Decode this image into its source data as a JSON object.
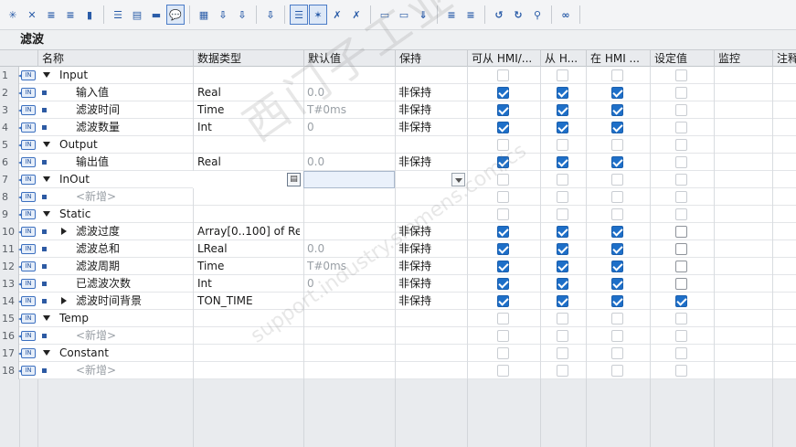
{
  "block_title": "滤波",
  "toolbar": {
    "icons": [
      "insert-row-icon",
      "add-row-icon",
      "move-up-icon",
      "move-down-icon",
      "reset-icon",
      "expand-icon",
      "collapse-icon",
      "block-icon",
      "comment-icon",
      "monitor-list-icon",
      "snapshot-icon",
      "load-start-icon",
      "view-icon",
      "highlight-icon",
      "break-icon",
      "delete-snapshot-icon",
      "copy-icon",
      "paste-icon",
      "download-icon",
      "parameters-icon",
      "sort-icon",
      "expand-all-icon",
      "refresh-icon",
      "link-icon",
      "glasses-icon",
      "db-icon"
    ]
  },
  "columns": [
    "名称",
    "数据类型",
    "默认值",
    "保持",
    "可从 HMI/...",
    "从 H...",
    "在 HMI ...",
    "设定值",
    "监控",
    "注释"
  ],
  "rows": [
    {
      "num": "1",
      "name": "Input",
      "level": 0,
      "type": "",
      "default": "",
      "retain": "",
      "c1": "off",
      "c2": "off",
      "c3": "off",
      "c4": "off",
      "caret": "down"
    },
    {
      "num": "2",
      "name": "输入值",
      "level": 1,
      "type": "Real",
      "default": "0.0",
      "retain": "非保持",
      "c1": "on",
      "c2": "on",
      "c3": "on",
      "c4": "off",
      "caret": ""
    },
    {
      "num": "3",
      "name": "滤波时间",
      "level": 1,
      "type": "Time",
      "default": "T#0ms",
      "retain": "非保持",
      "c1": "on",
      "c2": "on",
      "c3": "on",
      "c4": "off",
      "caret": ""
    },
    {
      "num": "4",
      "name": "滤波数量",
      "level": 1,
      "type": "Int",
      "default": "0",
      "retain": "非保持",
      "c1": "on",
      "c2": "on",
      "c3": "on",
      "c4": "off",
      "caret": ""
    },
    {
      "num": "5",
      "name": "Output",
      "level": 0,
      "type": "",
      "default": "",
      "retain": "",
      "c1": "off",
      "c2": "off",
      "c3": "off",
      "c4": "off",
      "caret": "down"
    },
    {
      "num": "6",
      "name": "输出值",
      "level": 1,
      "type": "Real",
      "default": "0.0",
      "retain": "非保持",
      "c1": "on",
      "c2": "on",
      "c3": "on",
      "c4": "off",
      "caret": ""
    },
    {
      "num": "7",
      "name": "InOut",
      "level": 0,
      "type": "",
      "default": "",
      "retain": "",
      "c1": "off",
      "c2": "off",
      "c3": "off",
      "c4": "off",
      "caret": "down"
    },
    {
      "num": "8",
      "name": "<新增>",
      "level": 1,
      "type": "",
      "default": "",
      "retain": "",
      "c1": "off",
      "c2": "off",
      "c3": "off",
      "c4": "off",
      "caret": "",
      "placeholder": true
    },
    {
      "num": "9",
      "name": "Static",
      "level": 0,
      "type": "",
      "default": "",
      "retain": "",
      "c1": "off",
      "c2": "off",
      "c3": "off",
      "c4": "off",
      "caret": "down"
    },
    {
      "num": "10",
      "name": "滤波过度",
      "level": 1,
      "type": "Array[0..100] of Real",
      "default": "",
      "retain": "非保持",
      "c1": "on",
      "c2": "on",
      "c3": "on",
      "c4": "offdark",
      "caret": "right"
    },
    {
      "num": "11",
      "name": "滤波总和",
      "level": 1,
      "type": "LReal",
      "default": "0.0",
      "retain": "非保持",
      "c1": "on",
      "c2": "on",
      "c3": "on",
      "c4": "offdark",
      "caret": ""
    },
    {
      "num": "12",
      "name": "滤波周期",
      "level": 1,
      "type": "Time",
      "default": "T#0ms",
      "retain": "非保持",
      "c1": "on",
      "c2": "on",
      "c3": "on",
      "c4": "offdark",
      "caret": ""
    },
    {
      "num": "13",
      "name": "已滤波次数",
      "level": 1,
      "type": "Int",
      "default": "0",
      "retain": "非保持",
      "c1": "on",
      "c2": "on",
      "c3": "on",
      "c4": "offdark",
      "caret": ""
    },
    {
      "num": "14",
      "name": "滤波时间背景",
      "level": 1,
      "type": "TON_TIME",
      "default": "",
      "retain": "非保持",
      "c1": "on",
      "c2": "on",
      "c3": "on",
      "c4": "on",
      "caret": "right"
    },
    {
      "num": "15",
      "name": "Temp",
      "level": 0,
      "type": "",
      "default": "",
      "retain": "",
      "c1": "off",
      "c2": "off",
      "c3": "off",
      "c4": "off",
      "caret": "down"
    },
    {
      "num": "16",
      "name": "<新增>",
      "level": 1,
      "type": "",
      "default": "",
      "retain": "",
      "c1": "off",
      "c2": "off",
      "c3": "off",
      "c4": "off",
      "caret": "",
      "placeholder": true
    },
    {
      "num": "17",
      "name": "Constant",
      "level": 0,
      "type": "",
      "default": "",
      "retain": "",
      "c1": "off",
      "c2": "off",
      "c3": "off",
      "c4": "off",
      "caret": "down"
    },
    {
      "num": "18",
      "name": "<新增>",
      "level": 1,
      "type": "",
      "default": "",
      "retain": "",
      "c1": "off",
      "c2": "off",
      "c3": "off",
      "c4": "off",
      "caret": "",
      "placeholder": true
    }
  ],
  "row_icon_text": "IN",
  "watermark": "西门子工业 技术论坛",
  "watermark_url": "support.industry.siemens.com/cs"
}
